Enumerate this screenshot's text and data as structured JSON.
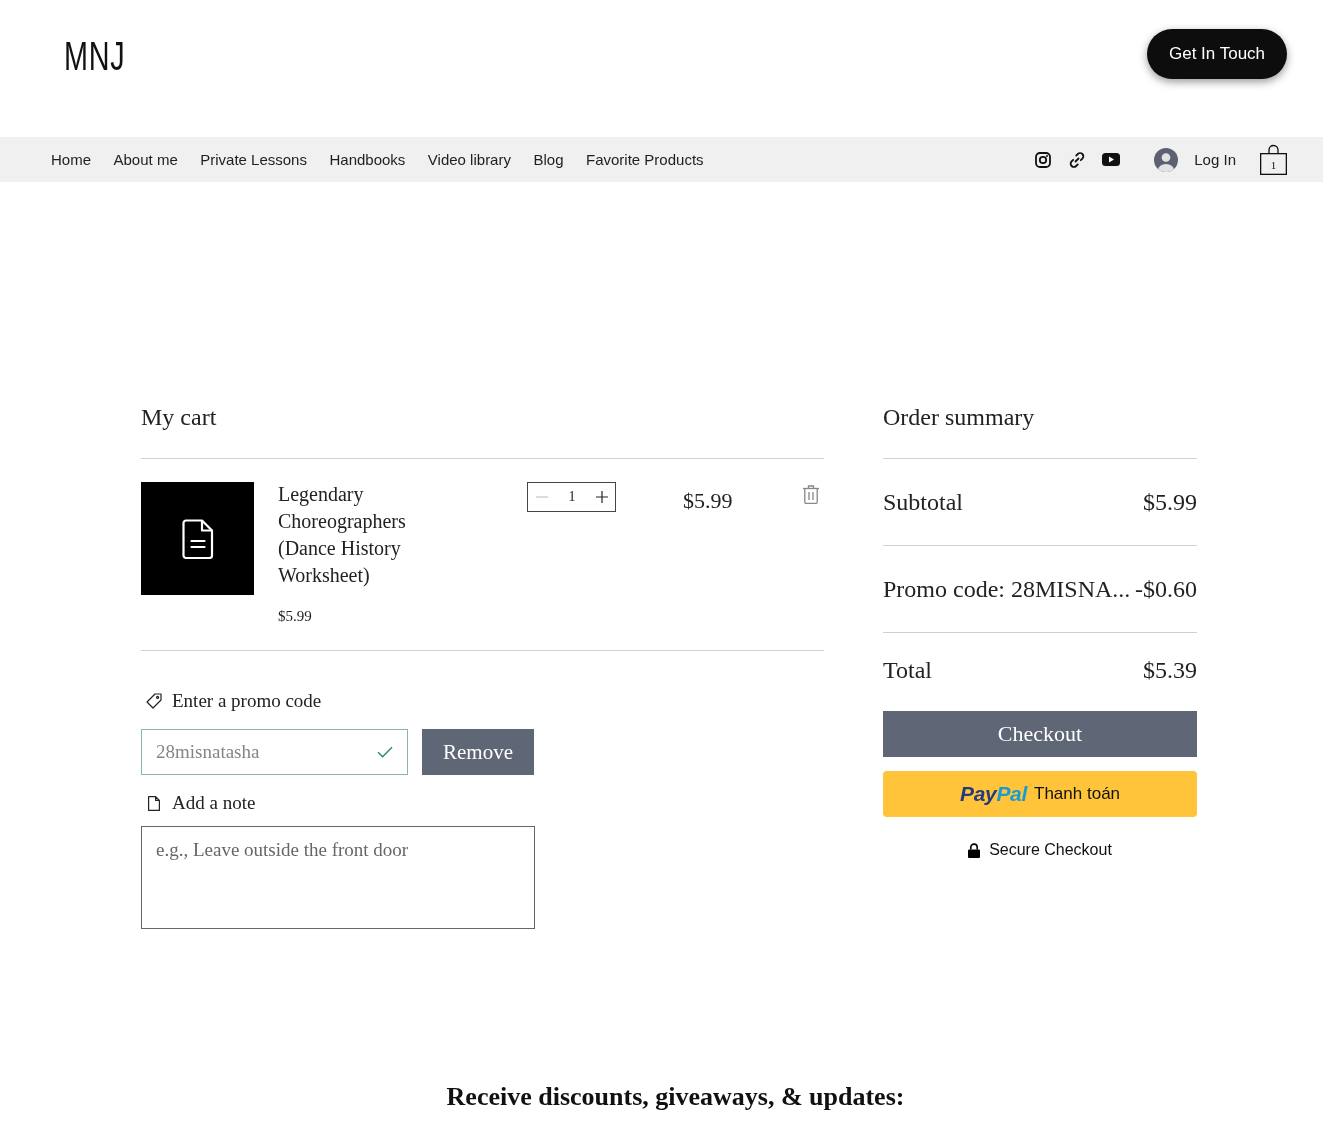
{
  "header": {
    "logo": "MNJ",
    "contact_button": "Get In Touch"
  },
  "nav": {
    "items": [
      {
        "label": "Home",
        "selected": false
      },
      {
        "label": "About me",
        "selected": false
      },
      {
        "label": "Private Lessons",
        "selected": false
      },
      {
        "label": "Handbooks",
        "selected": false
      },
      {
        "label": "Video library",
        "selected": false
      },
      {
        "label": "Blog",
        "selected": false
      },
      {
        "label": "Favorite Products",
        "selected": false
      }
    ],
    "login": "Log In",
    "cart_count": "1"
  },
  "cart": {
    "title": "My cart",
    "items": [
      {
        "name": "Legendary Choreographers (Dance History Worksheet)",
        "unit_price": "$5.99",
        "quantity": "1",
        "decrement_disabled": true,
        "total": "$5.99"
      }
    ],
    "promo": {
      "label": "Enter a promo code",
      "value": "28misnatasha",
      "applied": true,
      "button": "Remove"
    },
    "note": {
      "label": "Add a note",
      "placeholder": "e.g., Leave outside the front door"
    }
  },
  "summary": {
    "title": "Order summary",
    "rows": [
      {
        "label": "Subtotal",
        "value": "$5.99"
      },
      {
        "label": "Promo code: 28MISNA...",
        "value": "-$0.60"
      },
      {
        "label": "Total",
        "value": "$5.39"
      }
    ],
    "checkout_button": "Checkout",
    "paypal": {
      "logo": [
        "Pay",
        "Pal"
      ],
      "label": "Thanh toán"
    },
    "secure_note": "Secure Checkout"
  },
  "newsletter": {
    "title": "Receive discounts, giveaways, & updates:"
  }
}
